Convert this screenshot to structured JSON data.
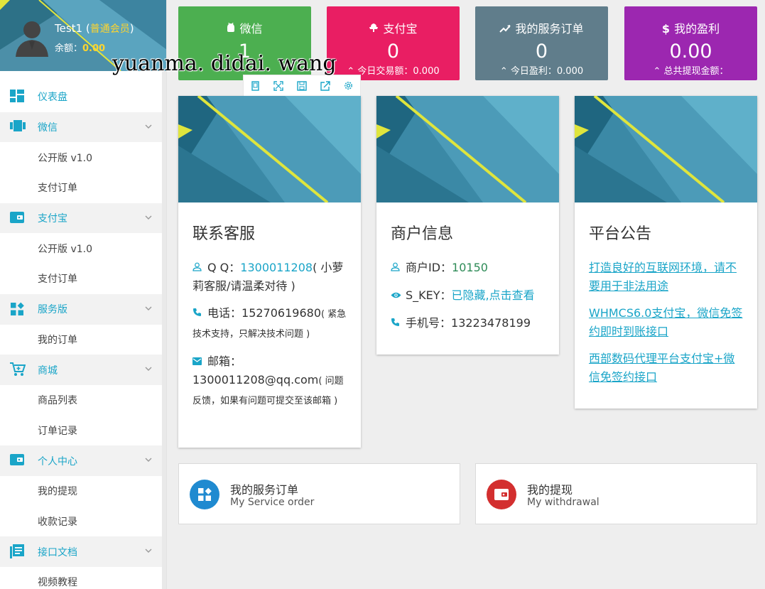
{
  "profile": {
    "username": "Test1",
    "level_prefix": "(",
    "level": "普通会员",
    "level_suffix": ")",
    "balance_label": "余额：",
    "balance": "0.00"
  },
  "menu": [
    {
      "type": "parent",
      "label": "仪表盘",
      "icon": "dashboard-icon",
      "caret": false
    },
    {
      "type": "parent",
      "label": "微信",
      "icon": "wechat-icon",
      "caret": true
    },
    {
      "type": "child",
      "label": "公开版 v1.0"
    },
    {
      "type": "child",
      "label": "支付订单"
    },
    {
      "type": "parent",
      "label": "支付宝",
      "icon": "wallet-icon",
      "caret": true
    },
    {
      "type": "child",
      "label": "公开版 v1.0"
    },
    {
      "type": "child",
      "label": "支付订单"
    },
    {
      "type": "parent",
      "label": "服务版",
      "icon": "widgets-icon",
      "caret": true
    },
    {
      "type": "child",
      "label": "我的订单"
    },
    {
      "type": "parent",
      "label": "商城",
      "icon": "cart-icon",
      "caret": true
    },
    {
      "type": "child",
      "label": "商品列表"
    },
    {
      "type": "child",
      "label": "订单记录"
    },
    {
      "type": "parent",
      "label": "个人中心",
      "icon": "wallet-icon",
      "caret": true
    },
    {
      "type": "child",
      "label": "我的提现"
    },
    {
      "type": "child",
      "label": "收款记录"
    },
    {
      "type": "parent",
      "label": "接口文档",
      "icon": "document-icon",
      "caret": true
    },
    {
      "type": "child",
      "label": "视频教程"
    }
  ],
  "stats": [
    {
      "title": "微信",
      "icon": "android-icon",
      "value": "1",
      "sub": "",
      "color": "#4caf50"
    },
    {
      "title": "支付宝",
      "icon": "alipay-icon",
      "value": "0",
      "sub": "今日交易额：0.000",
      "color": "#e91e63"
    },
    {
      "title": "我的服务订单",
      "icon": "trending-up-icon",
      "value": "0",
      "sub": "今日盈利：0.000",
      "color": "#607d8b"
    },
    {
      "title": "我的盈利",
      "icon": "dollar-icon",
      "value": "0.00",
      "sub": "总共提现金额：",
      "color": "#9c27b0"
    }
  ],
  "watermark": "yuanma. didai. wang",
  "toolbar": [
    "copy-icon",
    "fullscreen-icon",
    "save-icon",
    "share-icon",
    "settings-icon"
  ],
  "support": {
    "title": "联系客服",
    "qq_label": "Q Q：",
    "qq_value": "1300011208",
    "qq_note": "( 小萝莉客服/请温柔对待 )",
    "phone_label": "电话：",
    "phone_value": "15270619680",
    "phone_note": "( 紧急技术支持，只解决技术问题 )",
    "mail_label": "邮箱：",
    "mail_value": "1300011208@qq.com",
    "mail_note": "( 问题反馈，如果有问题可提交至该邮箱 )"
  },
  "merchant": {
    "title": "商户信息",
    "id_label": "商户ID：",
    "id_value": "10150",
    "key_label": "S_KEY：",
    "key_value": "已隐藏,点击查看",
    "mobile_label": "手机号：",
    "mobile_value": "13223478199"
  },
  "notice": {
    "title": "平台公告",
    "links": [
      "打造良好的互联网环境，请不要用于非法用途",
      "WHMCS6.0支付宝，微信免签约即时到账接口",
      "西部数码代理平台支付宝+微信免签约接口"
    ]
  },
  "boxes": [
    {
      "title": "我的服务订单",
      "sub": "My Service order",
      "color": "#1f8ad0",
      "icon": "widgets-icon"
    },
    {
      "title": "我的提现",
      "sub": "My withdrawal",
      "color": "#d32f2f",
      "icon": "wallet-icon"
    }
  ],
  "colors": {
    "accent": "#1aa5c8",
    "profile_gold": "#ffd52d"
  }
}
